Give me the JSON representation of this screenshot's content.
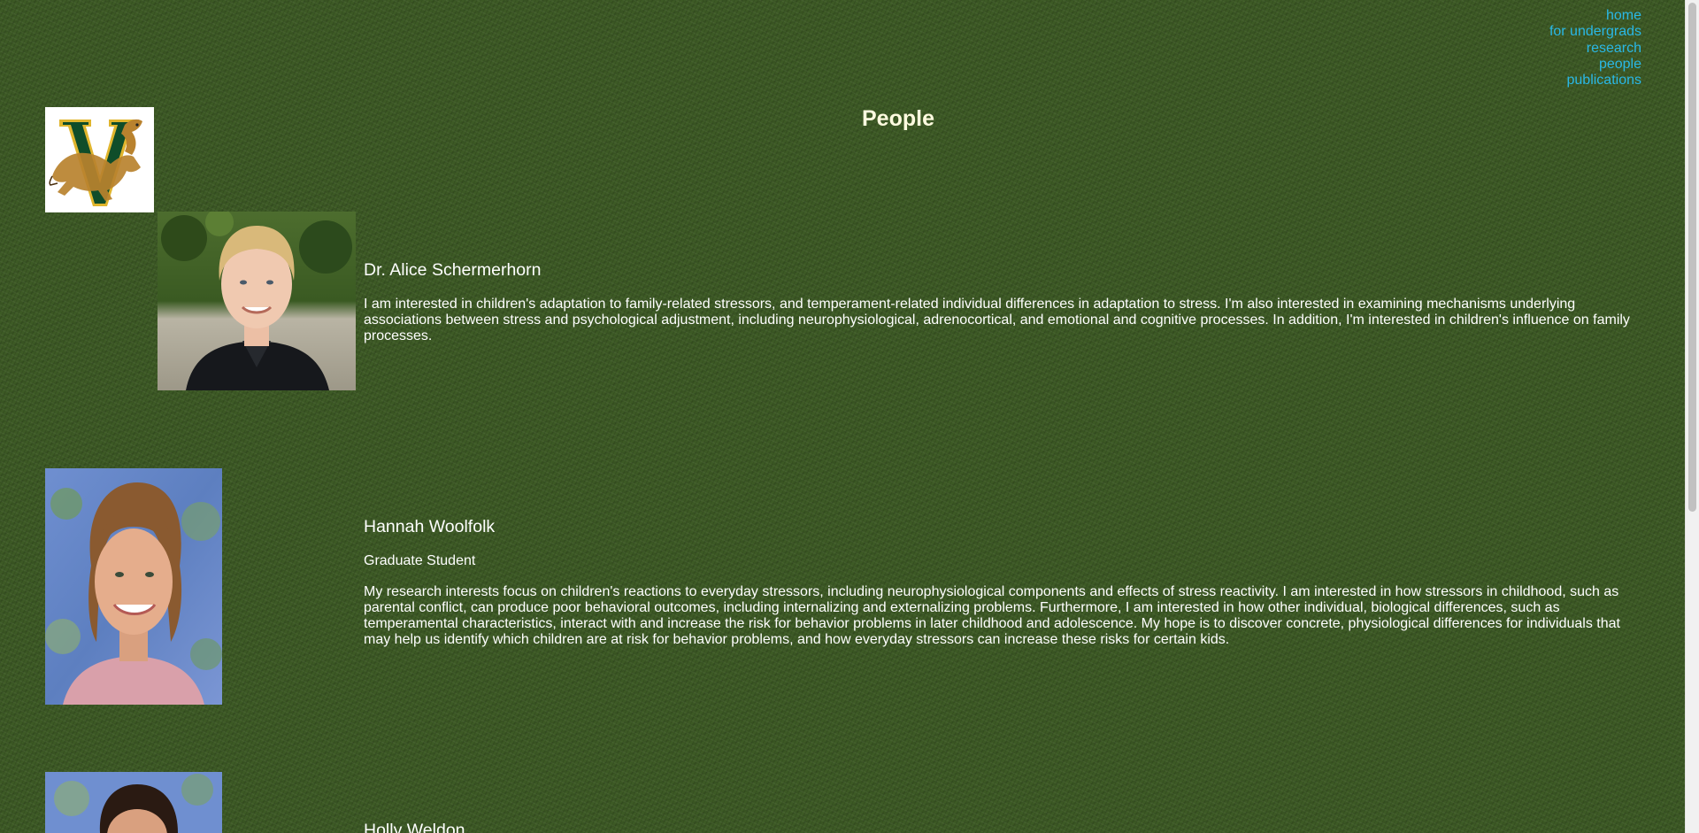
{
  "nav": {
    "items": [
      "home",
      "for undergrads",
      "research",
      "people",
      "publications"
    ]
  },
  "page": {
    "title": "People"
  },
  "people": [
    {
      "name": "Dr. Alice Schermerhorn",
      "role": "",
      "bio": "I am interested in children's adaptation to family-related stressors, and temperament-related individual differences in adaptation to stress. I'm also interested in examining mechanisms underlying associations between stress and psychological adjustment, including neurophysiological, adrenocortical, and emotional and cognitive processes. In addition, I'm interested in children's influence on family processes."
    },
    {
      "name": "Hannah Woolfolk",
      "role": "Graduate Student",
      "bio": "My research interests focus on children's reactions to everyday stressors, including neurophysiological components and effects of stress reactivity. I am interested in how stressors in childhood, such as parental conflict, can produce poor behavioral outcomes, including internalizing and externalizing problems. Furthermore, I am interested in how other individual, biological differences, such as temperamental characteristics, interact with and increase the risk for behavior problems in later childhood and adolescence. My hope is to discover concrete, physiological differences for individuals that may help us identify which children are at risk for behavior problems, and how everyday stressors can increase these risks for certain kids."
    },
    {
      "name": "Holly Weldon",
      "role": "",
      "bio": ""
    }
  ],
  "colors": {
    "background": "#3d5a25",
    "link": "#2ab8e6",
    "title": "#fffbe0",
    "text": "#ffffff",
    "logo_green": "#0f4d2a",
    "logo_gold": "#e0b52d"
  },
  "icons": {
    "logo": "vermont-catamount-v-logo"
  }
}
